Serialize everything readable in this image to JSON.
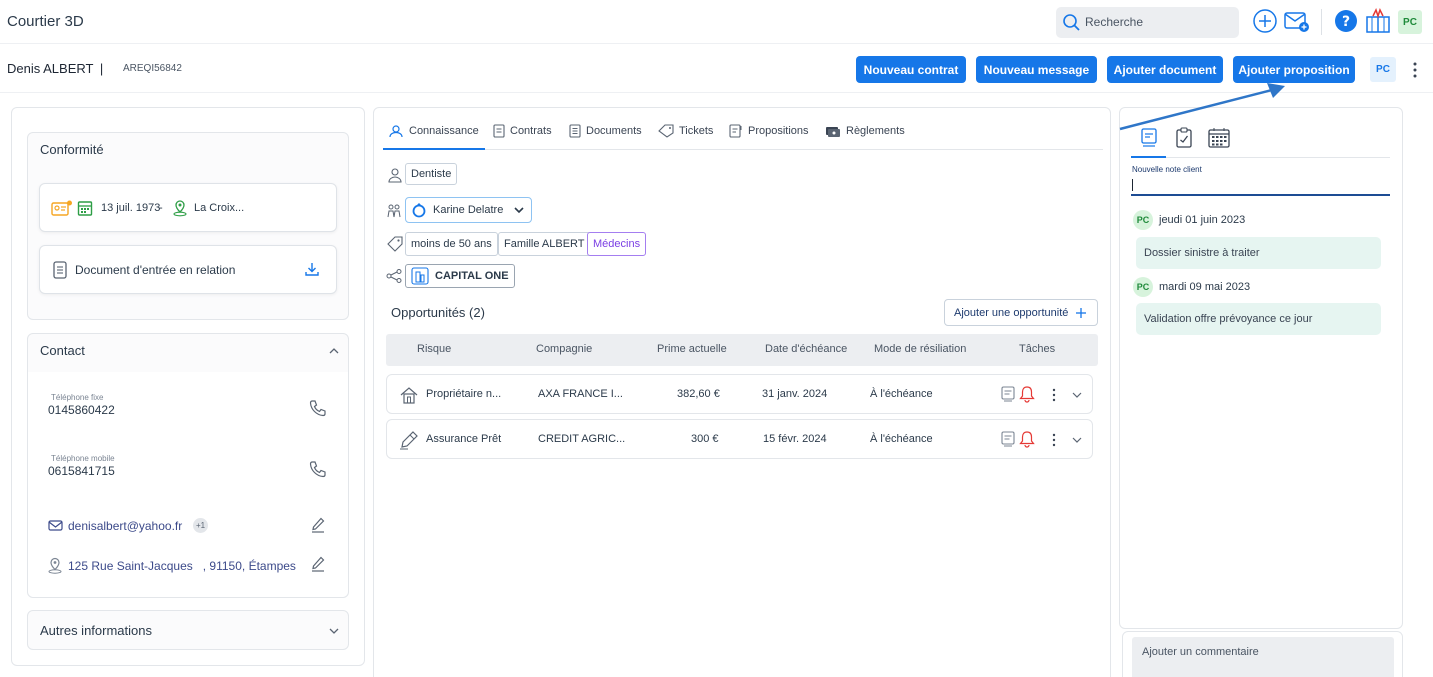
{
  "app": {
    "title": "Courtier 3D"
  },
  "topbar": {
    "search_label": "Recherche",
    "user_initials": "PC"
  },
  "client": {
    "name": "Denis ALBERT",
    "separator": "|",
    "reference": "AREQI56842",
    "user_initials": "PC"
  },
  "actions": {
    "new_contract": "Nouveau contrat",
    "new_message": "Nouveau message",
    "add_document": "Ajouter document",
    "add_proposal": "Ajouter proposition"
  },
  "conformite": {
    "title": "Conformité",
    "birth_date": "13 juil. 1973",
    "dash": "-",
    "birth_place": "La Croix...",
    "entry_doc": "Document d'entrée en relation"
  },
  "contact": {
    "title": "Contact",
    "landline_label": "Téléphone fixe",
    "landline": "0145860422",
    "mobile_label": "Téléphone mobile",
    "mobile": "0615841715",
    "email": "denisalbert@yahoo.fr",
    "email_extra": "+1",
    "address": "125 Rue Saint-Jacques   , 91150, Étampes"
  },
  "autres": {
    "title": "Autres informations"
  },
  "tabs": [
    {
      "label": "Connaissance",
      "icon": "user-icon"
    },
    {
      "label": "Contrats",
      "icon": "document-icon"
    },
    {
      "label": "Documents",
      "icon": "file-icon"
    },
    {
      "label": "Tickets",
      "icon": "tag-icon"
    },
    {
      "label": "Propositions",
      "icon": "proposal-icon"
    },
    {
      "label": "Règlements",
      "icon": "payment-icon"
    }
  ],
  "knowledge": {
    "profession": "Dentiste",
    "advisor": "Karine Delatre",
    "tags": [
      "moins de 50 ans",
      "Famille ALBERT",
      "Médecins"
    ],
    "company": "CAPITAL ONE"
  },
  "opportunities": {
    "title": "Opportunités (2)",
    "add_label": "Ajouter une opportunité",
    "columns": [
      "Risque",
      "Compagnie",
      "Prime actuelle",
      "Date d'échéance",
      "Mode de résiliation",
      "Tâches"
    ],
    "rows": [
      {
        "risk": "Propriétaire n...",
        "company": "AXA FRANCE I...",
        "premium": "382,60 €",
        "due_date": "31 janv. 2024",
        "mode": "À l'échéance"
      },
      {
        "risk": "Assurance Prêt",
        "company": "CREDIT AGRIC...",
        "premium": "300 €",
        "due_date": "15 févr. 2024",
        "mode": "À l'échéance"
      }
    ]
  },
  "notes": {
    "new_note_label": "Nouvelle note client",
    "entries": [
      {
        "initials": "PC",
        "date": "jeudi 01 juin 2023",
        "text": "Dossier sinistre à traiter"
      },
      {
        "initials": "PC",
        "date": "mardi 09 mai 2023",
        "text": "Validation offre prévoyance ce jour"
      }
    ],
    "comment_placeholder": "Ajouter un commentaire"
  },
  "colors": {
    "primary": "#1677e8",
    "note_bg": "#e6f5f1",
    "purple_tag": "#7b3fe4",
    "alert_red": "#e53935"
  }
}
